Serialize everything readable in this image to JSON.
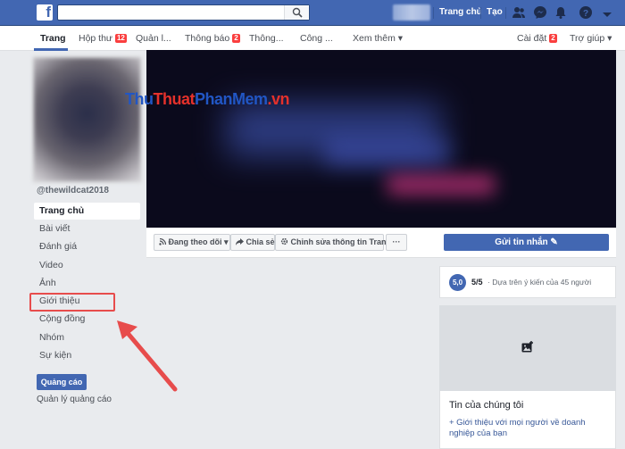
{
  "topbar": {
    "logo": "f",
    "links": {
      "home": "Trang chủ",
      "create": "Tạo"
    }
  },
  "pagenav": {
    "items": [
      {
        "label": "Trang"
      },
      {
        "label": "Hộp thư",
        "badge": "12"
      },
      {
        "label": "Quản l..."
      },
      {
        "label": "Thông báo",
        "badge": "2"
      },
      {
        "label": "Thông..."
      },
      {
        "label": "Công ..."
      },
      {
        "label": "Xem thêm ▾"
      }
    ],
    "settings": {
      "label": "Cài đặt",
      "badge": "2"
    },
    "help": "Trợ giúp ▾"
  },
  "sidebar": {
    "username": "@thewildcat2018",
    "items": [
      {
        "label": "Trang chủ"
      },
      {
        "label": "Bài viết"
      },
      {
        "label": "Đánh giá"
      },
      {
        "label": "Video"
      },
      {
        "label": "Ảnh"
      },
      {
        "label": "Giới thiệu"
      },
      {
        "label": "Cộng đồng"
      },
      {
        "label": "Nhóm"
      },
      {
        "label": "Sự kiện"
      }
    ],
    "ad_button": "Quảng cáo",
    "ad_manage": "Quản lý quảng cáo"
  },
  "cover": {
    "watermark": {
      "part1": "Thu",
      "part2": "Thuat",
      "part3": "PhanMem",
      "part4": ".vn"
    }
  },
  "actions": {
    "following": "Đang theo dõi ▾",
    "share": "Chia sẻ",
    "edit": "Chỉnh sửa thông tin Trang",
    "more": "···",
    "send": "Gửi tin nhắn ✎"
  },
  "rating": {
    "circle": "5,0",
    "score": "5/5",
    "text": "· Dựa trên ý kiến của 45 người"
  },
  "news": {
    "title": "Tin của chúng tôi",
    "link": "+ Giới thiệu với mọi người về doanh nghiệp của bạn"
  },
  "colors": {
    "brand": "#4267b2",
    "highlight": "#e74c4c",
    "badge": "#fa3e3e"
  }
}
